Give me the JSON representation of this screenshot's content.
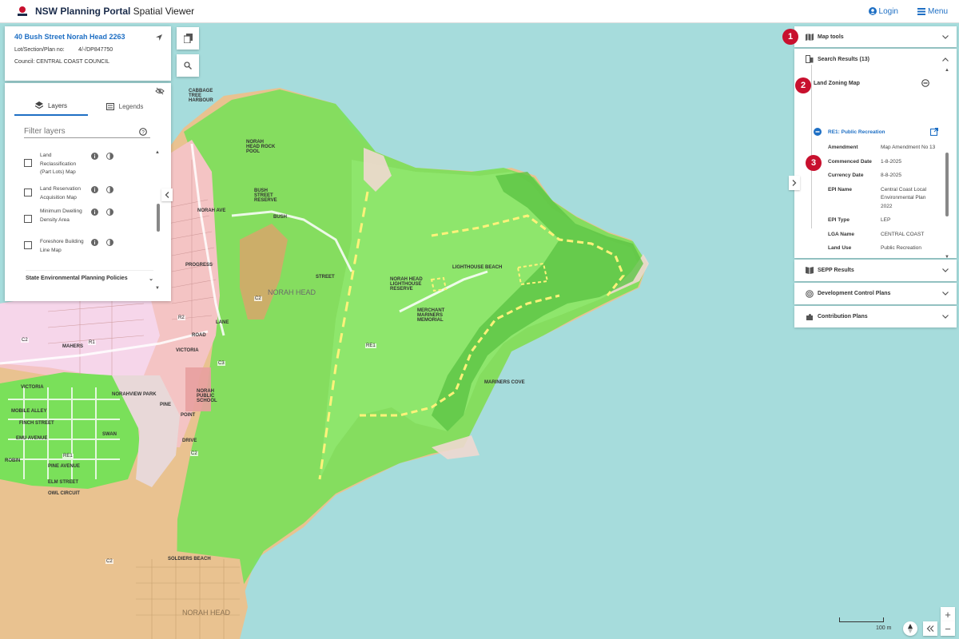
{
  "app": {
    "title_bold": "NSW Planning Portal",
    "title_rest": " Spatial Viewer",
    "logo_text": "NSW",
    "login": "Login",
    "menu": "Menu"
  },
  "address": {
    "title": "40 Bush Street Norah Head 2263",
    "lot_label": "Lot/Section/Plan no:",
    "lot_value": "4/-/DP847750",
    "council": "Council: CENTRAL COAST COUNCIL"
  },
  "layers": {
    "tabs": [
      "Layers",
      "Legends"
    ],
    "filter_placeholder": "Filter layers",
    "items": [
      {
        "label": "Land Reclassification (Part Lots) Map"
      },
      {
        "label": "Land Reservation Acquisition Map"
      },
      {
        "label": "Minimum Dwelling Density Area"
      },
      {
        "label": "Foreshore Building Line Map"
      }
    ],
    "section": "State Environmental Planning Policies"
  },
  "right": {
    "map_tools": "Map tools",
    "search_results": "Search Results (13)",
    "land_zoning": "Land Zoning Map",
    "zone": "RE1: Public Recreation",
    "fields": [
      {
        "key": "Amendment",
        "value": "Map Amendment No 13"
      },
      {
        "key": "Commenced Date",
        "value": "1-8-2025"
      },
      {
        "key": "Currency Date",
        "value": "8-8-2025"
      },
      {
        "key": "EPI Name",
        "value": "Central Coast Local Environmental Plan 2022"
      },
      {
        "key": "EPI Type",
        "value": "LEP"
      },
      {
        "key": "LGA Name",
        "value": "CENTRAL COAST"
      },
      {
        "key": "Land Use",
        "value": "Public Recreation"
      }
    ],
    "sepp": "SEPP Results",
    "dcp": "Development Control Plans",
    "contrib": "Contribution Plans"
  },
  "badges": [
    "1",
    "2",
    "3"
  ],
  "map": {
    "zone_codes": [
      "RE1",
      "RE1",
      "R1",
      "R2",
      "C2",
      "C2",
      "C2",
      "C3",
      "C3",
      "C2"
    ],
    "labels": {
      "cabbage_tree": "CABBAGE TREE HARBOUR",
      "norah_head": "NORAH HEAD",
      "norah_head_2": "NORAH HEAD",
      "rock_pool": "NORAH HEAD ROCK POOL",
      "bush_street": "BUSH",
      "street": "STREET",
      "bush_street_reserve": "BUSH STREET RESERVE",
      "lighthouse": "NORAH HEAD LIGHTHOUSE RESERVE",
      "merchant": "MERCHANT MARINERS MEMORIAL",
      "mariners_cove": "MARINERS COVE",
      "lighthouse_beach": "LIGHTHOUSE BEACH",
      "victoria": "VICTORIA",
      "victoria_2": "VICTORIA",
      "mobile_alley": "MOBILE ALLEY",
      "finch": "FINCH STREET",
      "emu_avenue": "EMU AVENUE",
      "pine_avenue": "PINE AVENUE",
      "elm_street": "ELM STREET",
      "owl_circuit": "OWL CIRCUIT",
      "swan": "SWAN",
      "robin": "ROBIN",
      "soldiers_beach": "SOLDIERS BEACH",
      "mahers": "MAHERS",
      "progress": "PROGRESS",
      "norah_ave": "NORAH AVE",
      "pine": "PINE",
      "point": "POINT",
      "drive": "DRIVE",
      "road": "ROAD",
      "lane": "LANE",
      "norahview": "NORAHVIEW PARK",
      "norah_public": "NORAH PUBLIC SCHOOL"
    },
    "scale_label": "100 m"
  },
  "colors": {
    "accent": "#1e6fc4",
    "badge": "#c8102e",
    "water": "#a6dcdc",
    "recreation_green": "#7ae05a",
    "conservation_tan": "#e9c290",
    "residential_pink": "#f4c4c4"
  }
}
